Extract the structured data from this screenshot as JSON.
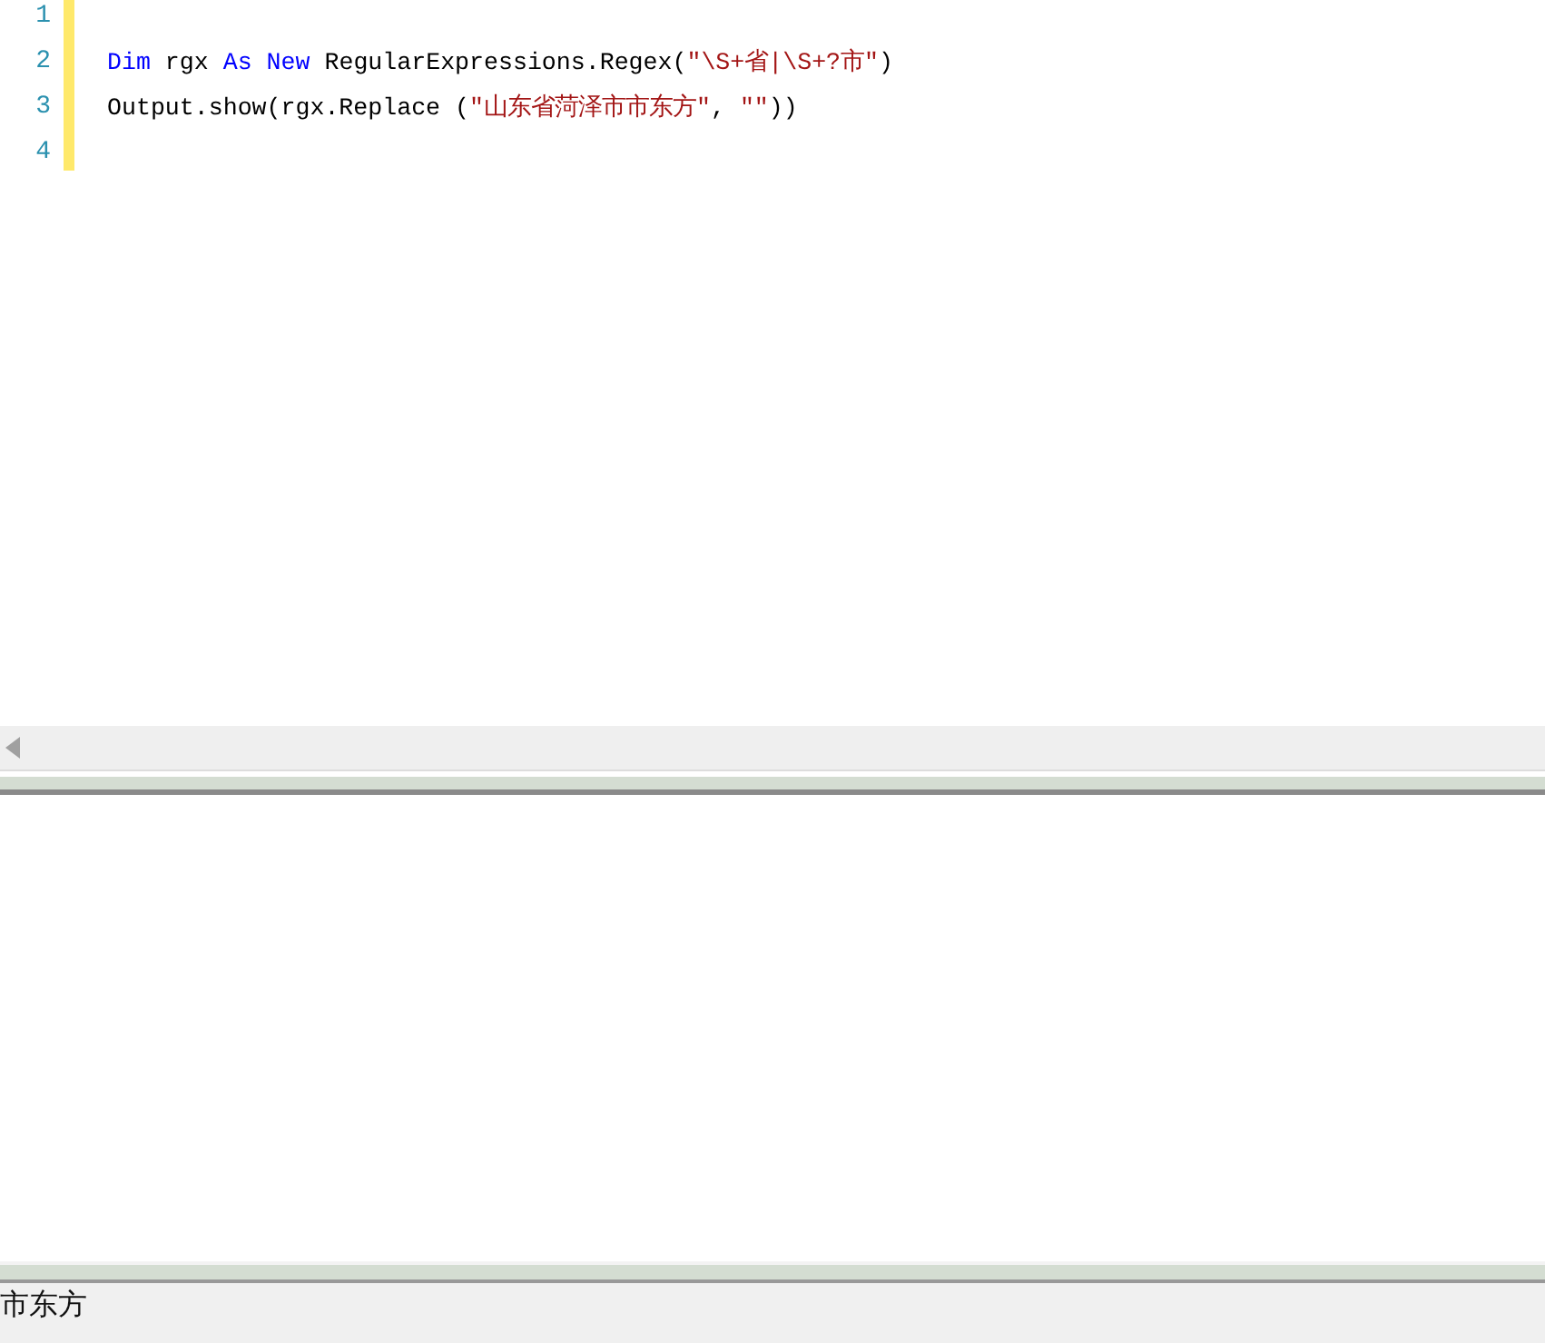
{
  "editor": {
    "lines": [
      {
        "number": "1"
      },
      {
        "number": "2",
        "tokens": [
          {
            "kind": "keyword",
            "text": "Dim"
          },
          {
            "kind": "plain",
            "text": " rgx "
          },
          {
            "kind": "keyword",
            "text": "As"
          },
          {
            "kind": "keyword",
            "text": " New"
          },
          {
            "kind": "plain",
            "text": " RegularExpressions.Regex("
          },
          {
            "kind": "string",
            "text": "\"\\S+省|\\S+?市\""
          },
          {
            "kind": "plain",
            "text": ")"
          }
        ]
      },
      {
        "number": "3",
        "tokens": [
          {
            "kind": "plain",
            "text": "Output.show(rgx.Replace ("
          },
          {
            "kind": "string",
            "text": "\"山东省菏泽市市东方\""
          },
          {
            "kind": "plain",
            "text": ", "
          },
          {
            "kind": "string",
            "text": "\"\""
          },
          {
            "kind": "plain",
            "text": "))"
          }
        ]
      },
      {
        "number": "4"
      }
    ]
  },
  "status_bar": {
    "text": "市东方"
  }
}
